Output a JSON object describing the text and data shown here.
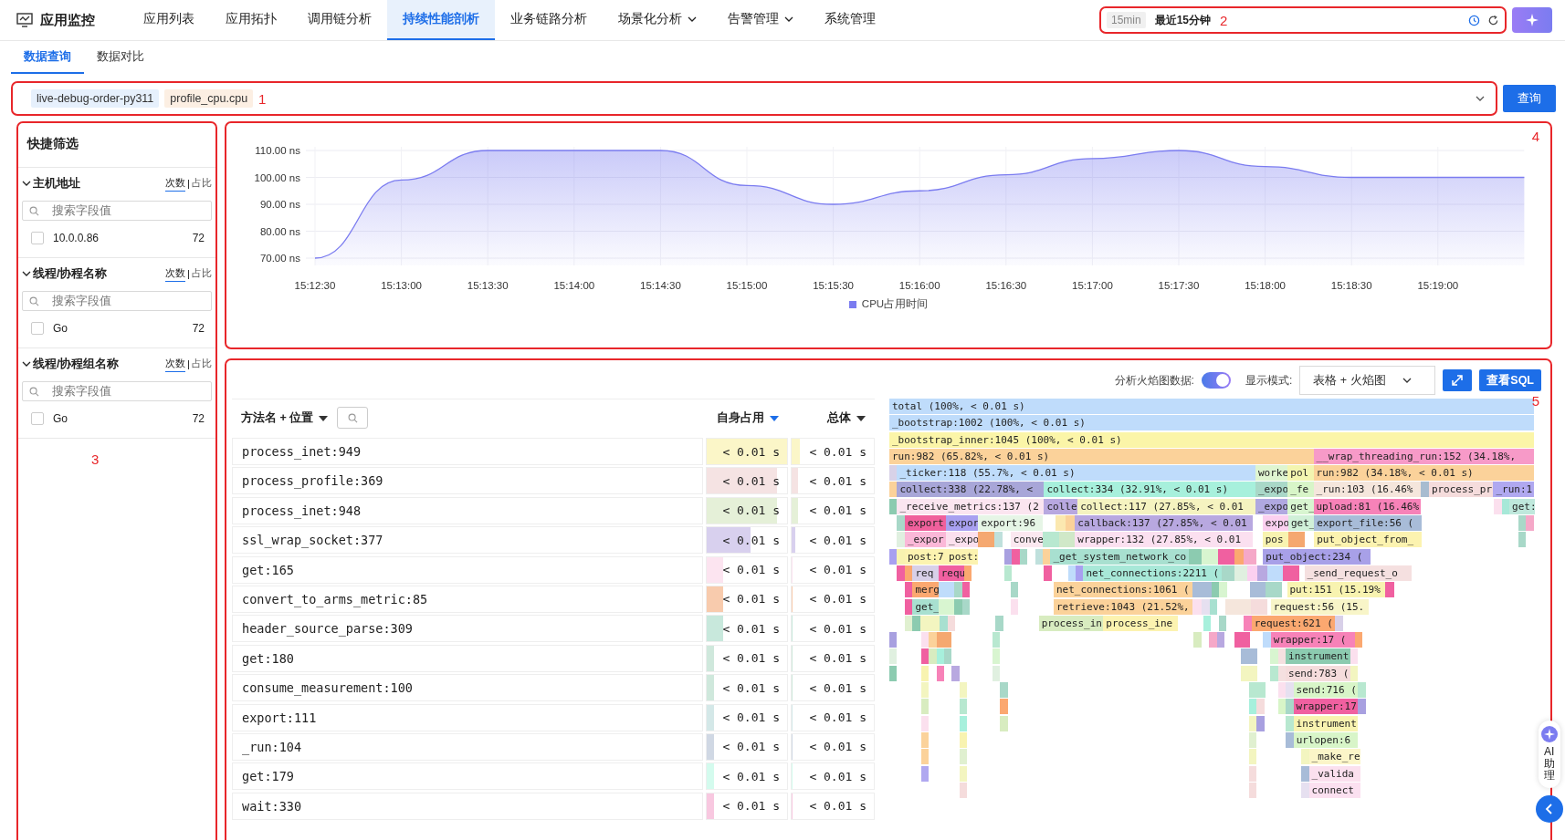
{
  "app": {
    "title": "应用监控"
  },
  "nav": [
    {
      "label": "应用列表",
      "selected": false,
      "dropdown": false
    },
    {
      "label": "应用拓扑",
      "selected": false,
      "dropdown": false
    },
    {
      "label": "调用链分析",
      "selected": false,
      "dropdown": false
    },
    {
      "label": "持续性能剖析",
      "selected": true,
      "dropdown": false
    },
    {
      "label": "业务链路分析",
      "selected": false,
      "dropdown": false
    },
    {
      "label": "场景化分析",
      "selected": false,
      "dropdown": true
    },
    {
      "label": "告警管理",
      "selected": false,
      "dropdown": true
    },
    {
      "label": "系统管理",
      "selected": false,
      "dropdown": false
    }
  ],
  "time_range": {
    "tag": "15min",
    "label": "最近15分钟",
    "annotation": "2"
  },
  "sub_tabs": [
    {
      "label": "数据查询",
      "selected": true
    },
    {
      "label": "数据对比",
      "selected": false
    }
  ],
  "query": {
    "annotation": "1",
    "button": "查询",
    "tags": [
      {
        "text": "live-debug-order-py311",
        "color": "#e6f0fc"
      },
      {
        "text": "profile_cpu.cpu",
        "color": "#fcefe3"
      }
    ]
  },
  "quick_filter": {
    "title": "快捷筛选",
    "annotation": "3",
    "groups": [
      {
        "title": "主机地址",
        "expanded": true,
        "modes": [
          {
            "label": "次数",
            "selected": true
          },
          {
            "label": "占比",
            "selected": false
          }
        ],
        "search_placeholder": "搜索字段值",
        "items": [
          {
            "label": "10.0.0.86",
            "count": "72",
            "checked": false
          }
        ]
      },
      {
        "title": "线程/协程名称",
        "expanded": true,
        "modes": [
          {
            "label": "次数",
            "selected": true
          },
          {
            "label": "占比",
            "selected": false
          }
        ],
        "search_placeholder": "搜索字段值",
        "items": [
          {
            "label": "Go",
            "count": "72",
            "checked": false
          }
        ]
      },
      {
        "title": "线程/协程组名称",
        "expanded": true,
        "modes": [
          {
            "label": "次数",
            "selected": true
          },
          {
            "label": "占比",
            "selected": false
          }
        ],
        "search_placeholder": "搜索字段值",
        "items": [
          {
            "label": "Go",
            "count": "72",
            "checked": false
          }
        ]
      }
    ]
  },
  "chart_panel": {
    "annotation": "4",
    "chart_data": {
      "type": "area",
      "grid": true,
      "categories": [
        "15:12:30",
        "15:13:00",
        "15:13:30",
        "15:14:00",
        "15:14:30",
        "15:15:00",
        "15:15:30",
        "15:16:00",
        "15:16:30",
        "15:17:00",
        "15:17:30",
        "15:18:00",
        "15:18:30",
        "15:19:00",
        null
      ],
      "series": [
        {
          "name": "CPU占用时间",
          "color": "#7b7cf0",
          "values": [
            70,
            99,
            110,
            110,
            110,
            97,
            90,
            95,
            101,
            107,
            110,
            104,
            100,
            100,
            100
          ]
        }
      ],
      "ylim": [
        70,
        110
      ],
      "yticks": [
        {
          "value": 70,
          "label": "70.00 ns"
        },
        {
          "value": 80,
          "label": "80.00 ns"
        },
        {
          "value": 90,
          "label": "90.00 ns"
        },
        {
          "value": 100,
          "label": "100.00 ns"
        },
        {
          "value": 110,
          "label": "110.00 ns"
        }
      ]
    }
  },
  "profile_panel": {
    "annotation": "5",
    "flame_toggle": {
      "label": "分析火焰图数据:",
      "on": true
    },
    "display_mode": {
      "label": "显示模式:",
      "value": "表格 + 火焰图"
    },
    "sql_button": "查看SQL",
    "table": {
      "columns": [
        {
          "label": "方法名 + 位置",
          "sort_active": false,
          "search": true
        },
        {
          "label": "自身占用",
          "sort_active": true,
          "search": false
        },
        {
          "label": "总体",
          "sort_active": false,
          "search": false
        }
      ],
      "rows": [
        {
          "name": "process_inet:949",
          "self": "< 0.01 s",
          "total": "< 0.01 s",
          "color": "#fbf6c8",
          "self_bar": {
            "level": 1
          },
          "total_bar": {
            "level": 0.1
          }
        },
        {
          "name": "process_profile:369",
          "self": "< 0.01 s",
          "total": "< 0.01 s",
          "color": "#f5e3e3",
          "self_bar": {
            "level": 0.88
          },
          "total_bar": {
            "level": 0.08
          }
        },
        {
          "name": "process_inet:948",
          "self": "< 0.01 s",
          "total": "< 0.01 s",
          "color": "#e5f0d8",
          "self_bar": {
            "level": 0.88
          },
          "total_bar": {
            "level": 0.08
          }
        },
        {
          "name": "ssl_wrap_socket:377",
          "self": "< 0.01 s",
          "total": "< 0.01 s",
          "color": "#d8d0ee",
          "self_bar": {
            "level": 0.55
          },
          "total_bar": {
            "level": 0.04
          }
        },
        {
          "name": "get:165",
          "self": "< 0.01 s",
          "total": "< 0.01 s",
          "color": "#fce4f0",
          "self_bar": {
            "level": 0.2
          },
          "total_bar": {
            "level": 0.01
          }
        },
        {
          "name": "convert_to_arms_metric:85",
          "self": "< 0.01 s",
          "total": "< 0.01 s",
          "color": "#f8cbad",
          "self_bar": {
            "level": 0.2
          },
          "total_bar": {
            "level": 0.01
          }
        },
        {
          "name": "header_source_parse:309",
          "self": "< 0.01 s",
          "total": "< 0.01 s",
          "color": "#c8e8dc",
          "self_bar": {
            "level": 0.2
          },
          "total_bar": {
            "level": 0.01
          }
        },
        {
          "name": "get:180",
          "self": "< 0.01 s",
          "total": "< 0.01 s",
          "color": "#cfe8dc",
          "self_bar": {
            "level": 0.09
          },
          "total_bar": {
            "level": 0.01
          }
        },
        {
          "name": "consume_measurement:100",
          "self": "< 0.01 s",
          "total": "< 0.01 s",
          "color": "#cfe8dc",
          "self_bar": {
            "level": 0.09
          },
          "total_bar": {
            "level": 0.01
          }
        },
        {
          "name": "export:111",
          "self": "< 0.01 s",
          "total": "< 0.01 s",
          "color": "#d4e8e8",
          "self_bar": {
            "level": 0.09
          },
          "total_bar": {
            "level": 0.01
          }
        },
        {
          "name": "_run:104",
          "self": "< 0.01 s",
          "total": "< 0.01 s",
          "color": "#d0d8e4",
          "self_bar": {
            "level": 0.09
          },
          "total_bar": {
            "level": 0.01
          }
        },
        {
          "name": "get:179",
          "self": "< 0.01 s",
          "total": "< 0.01 s",
          "color": "#d4fbee",
          "self_bar": {
            "level": 0.09
          },
          "total_bar": {
            "level": 0.01
          }
        },
        {
          "name": "wait:330",
          "self": "< 0.01 s",
          "total": "< 0.01 s",
          "color": "#f8c8e0",
          "self_bar": {
            "level": 0.09
          },
          "total_bar": {
            "level": 0.01
          }
        }
      ]
    },
    "flame_rows": [
      [
        {
          "text": "total (100%, < 0.01 s)",
          "color": "#bfdcfb"
        }
      ],
      [
        {
          "text": "_bootstrap:1002 (100%, < 0.01 s)",
          "color": "#bfdcfb"
        }
      ],
      [
        {
          "text": "_bootstrap_inner:1045 (100%, < 0.01 s)",
          "color": "#fbf5a8"
        }
      ],
      [
        {
          "text": "run:982 (65.82%, < 0.01 s)",
          "color": "#fbd29a"
        },
        {
          "text": "__wrap_threading_run:152 (34.18%,",
          "color": "#f79ac8"
        }
      ],
      [
        {
          "color": "#d8d2e8"
        },
        {
          "text": "_ticker:118 (55.7%, < 0.01 s)",
          "color": "#bfdcfb"
        },
        {
          "text": "worke",
          "color": "#dff5d0"
        },
        {
          "text": "pol",
          "color": "#f3f5b0"
        },
        {
          "text": "run:982 (34.18%, < 0.01 s)",
          "color": "#fbd29a"
        }
      ],
      [
        {
          "color": "#fbd29a"
        },
        {
          "text": "collect:338 (22.78%, <",
          "color": "#a8a6d8"
        },
        {
          "text": "collect:334 (32.91%, < 0.01 s)",
          "color": "#a7f0dc"
        },
        {
          "text": "_expo",
          "color": "#a9d8c8"
        },
        {
          "text": "_fe",
          "color": "#d8f5c8"
        },
        {
          "text": "_run:103 (16.46%",
          "color": "#f5e6dc"
        },
        {
          "color": "#a8bcd0"
        },
        {
          "text": "process_pr",
          "color": "#f5dcdc"
        },
        {
          "text": "_run:1",
          "color": "#b0a8f0"
        }
      ],
      [
        {
          "color": "#8ccbb0"
        },
        {
          "text": "_receive_metrics:137 (2",
          "color": "#fbe5f0"
        },
        {
          "text": "colle",
          "color": "#b8a8e0"
        },
        {
          "text": "collect:117 (27.85%, < 0.01",
          "color": "#f5f3c0"
        },
        {
          "text": "_expo",
          "color": "#b0a8e0"
        },
        {
          "text": "get_",
          "color": "#d8f5d0"
        },
        {
          "text": "upload:81 (16.46%",
          "color": "#f782b8"
        },
        {
          "color": "#fbe0ee"
        },
        {
          "color": "#a7e8d8"
        },
        {
          "text": "get:",
          "color": "#bfe8dc"
        }
      ],
      [
        {
          "color": "#a8d8c8"
        },
        {
          "text": "export",
          "color": "#f0609c"
        },
        {
          "text": "expor",
          "color": "#a8a0f0"
        },
        {
          "text": "export:96",
          "color": "#e6f5e6"
        },
        {
          "color": "#fbe8b0"
        },
        {
          "color": "#fbd29a"
        },
        {
          "text": "callback:137 (27.85%, < 0.01",
          "color": "#b8a8e0"
        },
        {
          "text": "expo",
          "color": "#fbd0f0"
        },
        {
          "text": "get_",
          "color": "#d0f0d8"
        },
        {
          "text": "export_file:56 (",
          "color": "#a8bcd8"
        },
        {
          "color": "#a8d8c8"
        },
        {
          "color": "#f5a8c8"
        }
      ],
      [
        {
          "color": "#e0f0e0"
        },
        {
          "text": "_expor",
          "color": "#fbb8d8"
        },
        {
          "text": "_expo",
          "color": "#fbe0ee"
        },
        {
          "color": "#f5a870"
        },
        {
          "color": "#bfe0dc"
        },
        {
          "text": "conve",
          "color": "#fbe8f0"
        },
        {
          "color": "#b8e8d0"
        },
        {
          "color": "#d0e8c8"
        },
        {
          "text": "wrapper:132 (27.85%, < 0.01",
          "color": "#fbe0f0"
        },
        {
          "text": "pos",
          "color": "#f8f3b0"
        },
        {
          "color": "#f5a870"
        },
        {
          "text": "put_object_from_",
          "color": "#fcf3b0"
        },
        {
          "color": "#a8d8c8"
        }
      ],
      [
        {
          "color": "#a8a0f0"
        },
        {
          "color": "#f8f3b0"
        },
        {
          "text": "post:7",
          "color": "#fcf3b0"
        },
        {
          "text": "post:",
          "color": "#fcf3b0"
        },
        {
          "color": "#a8a0e0"
        },
        {
          "color": "#f060a0"
        },
        {
          "color": "#a8d8c8"
        },
        {
          "color": "#bfe0dc"
        },
        {
          "color": "#fbd29a"
        },
        {
          "text": "_get_system_network_co",
          "color": "#a8e0d0"
        },
        {
          "color": "#8ccbb0"
        },
        {
          "color": "#d8f5d0"
        },
        {
          "color": "#f060a0"
        },
        {
          "color": "#fba870"
        },
        {
          "color": "#f5a8c8"
        },
        {
          "text": "put_object:234 (",
          "color": "#a8a0e8"
        }
      ],
      [
        {
          "color": "#f060a0"
        },
        {
          "color": "#fba870"
        },
        {
          "text": "req",
          "color": "#d8d0e8"
        },
        {
          "text": "requ",
          "color": "#f060a0"
        },
        {
          "color": "#fba870"
        },
        {
          "color": "#b8e8d0"
        },
        {
          "color": "#f060a0"
        },
        {
          "color": "#bfdcfb"
        },
        {
          "color": "#a8a0f0"
        },
        {
          "text": "net_connections:2211 (",
          "color": "#a8e8d8"
        },
        {
          "color": "#a8d8c8"
        },
        {
          "color": "#e0f0e0"
        },
        {
          "color": "#fbd0f0"
        },
        {
          "color": "#b8a8e0"
        },
        {
          "color": "#bfdcfb"
        },
        {
          "color": "#f060a0"
        },
        {
          "text": "_send_request_o",
          "color": "#f5e0e0"
        }
      ],
      [
        {
          "color": "#f060a0"
        },
        {
          "text": "merg",
          "color": "#fba870"
        },
        {
          "color": "#bfdcfb"
        },
        {
          "color": "#a8d8c8"
        },
        {
          "color": "#f060a0"
        },
        {
          "color": "#a8d8c8"
        },
        {
          "text": "net_connections:1061 (",
          "color": "#fbd29a"
        },
        {
          "color": "#a8bcd8"
        },
        {
          "color": "#8ccbb0"
        },
        {
          "color": "#d8f5d0"
        },
        {
          "color": "#a8bcd8"
        },
        {
          "color": "#a8d8c8"
        },
        {
          "text": "put:151 (15.19%",
          "color": "#f8f3b0"
        },
        {
          "color": "#f060a0"
        }
      ],
      [
        {
          "color": "#f060a0"
        },
        {
          "text": "get_",
          "color": "#a8e0d0"
        },
        {
          "color": "#d8f5d0"
        },
        {
          "color": "#8ccbb0"
        },
        {
          "color": "#a8d8c8"
        },
        {
          "color": "#fbe0ee"
        },
        {
          "text": "retrieve:1043 (21.52%,",
          "color": "#fbd29a"
        },
        {
          "color": "#fbe0ee"
        },
        {
          "color": "#e6e0f0"
        },
        {
          "color": "#a8e0d0"
        },
        {
          "color": "#f5e6dc"
        },
        {
          "color": "#f5dcdc"
        },
        {
          "text": "request:56 (15.",
          "color": "#f8f5c8"
        }
      ],
      [
        {
          "color": "#e0f0d0"
        },
        {
          "color": "#8ccbb0"
        },
        {
          "color": "#f3f5c0"
        },
        {
          "color": "#a8e0d0"
        },
        {
          "color": "#f5dcdc"
        },
        {
          "color": "#a8d8c8"
        },
        {
          "text": "process_in",
          "color": "#d8ecc0"
        },
        {
          "text": "process_ine",
          "color": "#fcf3b0"
        },
        {
          "color": "#a7f0dc"
        },
        {
          "color": "#a8d8c8"
        },
        {
          "color": "#f782b8"
        },
        {
          "text": "request:621 (",
          "color": "#fba870"
        },
        {
          "color": "#d8d0e8"
        }
      ],
      [
        {
          "color": "#a8a0e0"
        },
        {
          "color": "#fbe0ee"
        },
        {
          "color": "#fbd29a"
        },
        {
          "color": "#f5a870"
        },
        {
          "color": "#f5a870"
        },
        {
          "color": "#b8e8d0"
        },
        {
          "color": "#d8ecc0"
        },
        {
          "color": "#f5a8c8"
        },
        {
          "color": "#b8a8e0"
        },
        {
          "color": "#f060a0"
        },
        {
          "color": "#bfdcfb"
        },
        {
          "text": "wrapper:17 (",
          "color": "#f782b8"
        },
        {
          "color": "#fba870"
        }
      ],
      [
        {
          "color": "#e0f0e0"
        },
        {
          "color": "#f060a0"
        },
        {
          "color": "#d8ecc0"
        },
        {
          "color": "#a7f0dc"
        },
        {
          "color": "#a8d8c8"
        },
        {
          "color": "#d8f5d0"
        },
        {
          "color": "#a8bcd8"
        },
        {
          "color": "#d8f5d0"
        },
        {
          "color": "#f5e0e0"
        },
        {
          "text": "instrument",
          "color": "#8ccbb0"
        },
        {
          "color": "#fbe0ee"
        }
      ],
      [
        {
          "color": "#8ccbb0"
        },
        {
          "color": "#f8f3b0"
        },
        {
          "color": "#f782b8"
        },
        {
          "color": "#b8a8e0"
        },
        {
          "color": "#e0f0e0"
        },
        {
          "color": "#f3f5c0"
        },
        {
          "color": "#b8e8d0"
        },
        {
          "color": "#f5e0e0"
        },
        {
          "text": "send:783 (",
          "color": "#f5dcdc"
        },
        {
          "color": "#f3f5c0"
        }
      ],
      [
        {
          "color": "#f3f5c0"
        },
        {
          "color": "#f3f5c0"
        },
        {
          "color": "#a8d8c8"
        },
        {
          "color": "#b8e8d0"
        },
        {
          "color": "#fbe0ee"
        },
        {
          "color": "#e6e0f0"
        },
        {
          "text": "send:716 (",
          "color": "#d8f5c8"
        },
        {
          "color": "#b8e8d0"
        }
      ],
      [
        {
          "color": "#d8ecc0"
        },
        {
          "color": "#b8e8d0"
        },
        {
          "color": "#fba870"
        },
        {
          "color": "#a7f0dc"
        },
        {
          "color": "#f5dcdc"
        },
        {
          "color": "#d8f5c8"
        },
        {
          "color": "#a8d8c8"
        },
        {
          "text": "wrapper:17",
          "color": "#f060a0"
        },
        {
          "color": "#a8a0e0"
        }
      ],
      [
        {
          "color": "#fbe0ee"
        },
        {
          "color": "#a7f0dc"
        },
        {
          "color": "#d8ecc0"
        },
        {
          "color": "#f3f5c0"
        },
        {
          "color": "#a8a0e0"
        },
        {
          "color": "#b8e8d0"
        },
        {
          "text": "instrument",
          "color": "#f8f3b0"
        }
      ],
      [
        {
          "color": "#fbd29a"
        },
        {
          "color": "#f8f3b0"
        },
        {
          "color": "#e0f0d0"
        },
        {
          "color": "#a8bcd8"
        },
        {
          "text": "urlopen:6",
          "color": "#d8f5c8"
        }
      ],
      [
        {
          "color": "#fbd29a"
        },
        {
          "color": "#e0f0d0"
        },
        {
          "color": "#f3f5c0"
        },
        {
          "color": "#f3f5c0"
        },
        {
          "text": "_make_re",
          "color": "#fbf5c8"
        }
      ],
      [
        {
          "color": "#b0a8f0"
        },
        {
          "color": "#f3f5c0"
        },
        {
          "color": "#f5dcdc"
        },
        {
          "color": "#a8bcd8"
        },
        {
          "text": "_valida",
          "color": "#fbe0ee"
        }
      ],
      [
        {
          "color": "#f5dcdc"
        },
        {
          "color": "#f5dcdc"
        },
        {
          "color": "#e6e0f0"
        },
        {
          "text": "connect",
          "color": "#fbe0f0"
        }
      ]
    ]
  },
  "assistant": {
    "label": "AI助理"
  }
}
